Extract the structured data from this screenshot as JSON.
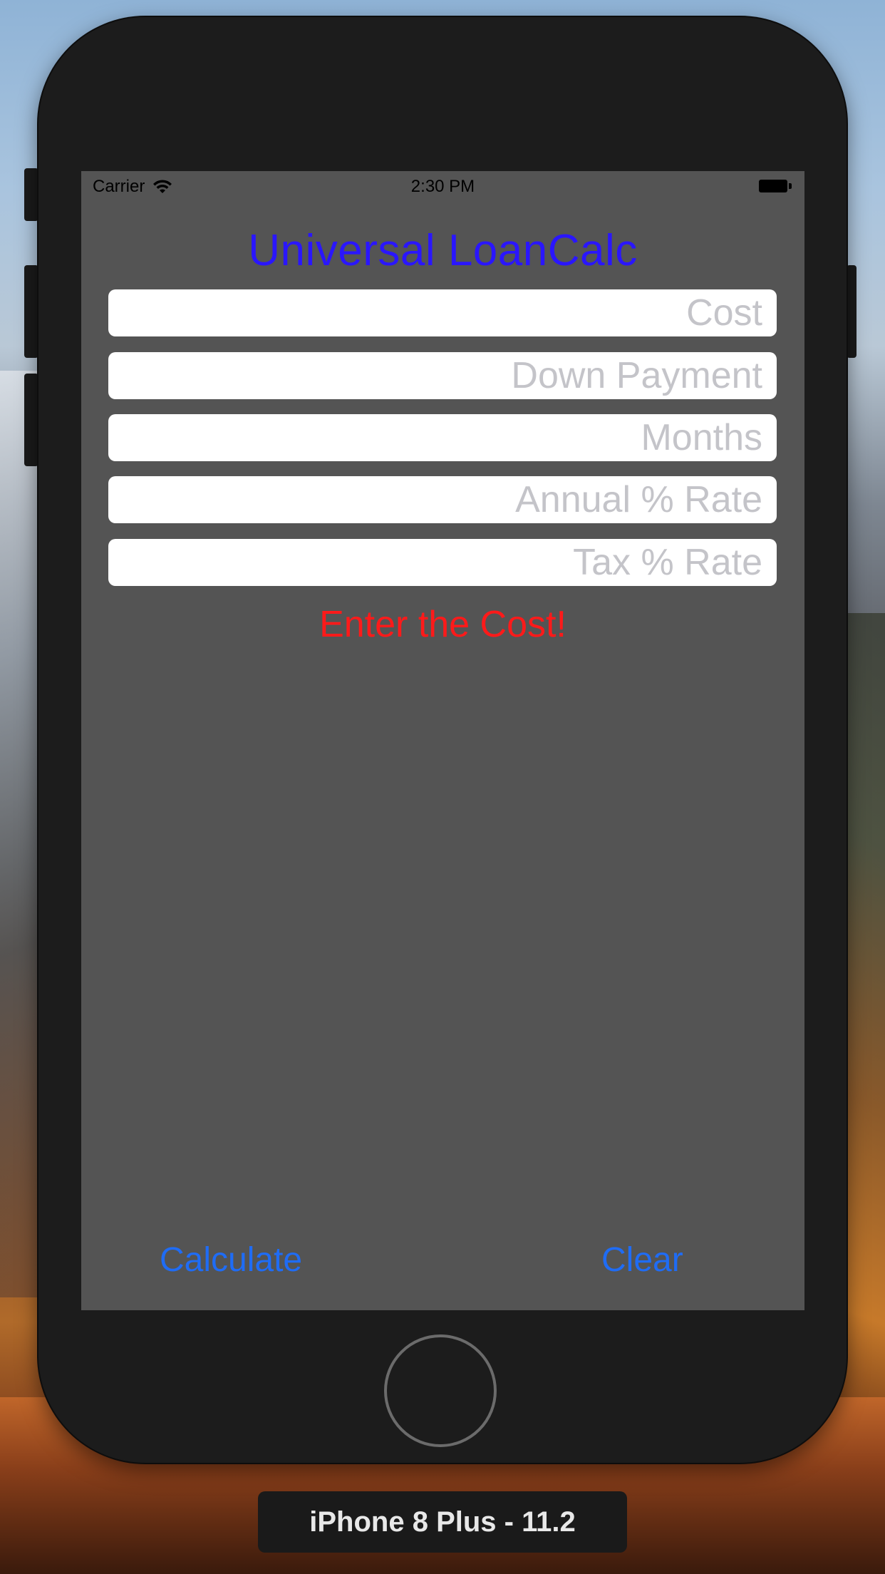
{
  "status_bar": {
    "carrier": "Carrier",
    "time": "2:30 PM"
  },
  "app": {
    "title": "Universal LoanCalc",
    "title_color": "#2a16ff",
    "fields": {
      "cost": {
        "value": "",
        "placeholder": "Cost"
      },
      "down_payment": {
        "value": "",
        "placeholder": "Down Payment"
      },
      "months": {
        "value": "",
        "placeholder": "Months"
      },
      "annual_rate": {
        "value": "",
        "placeholder": "Annual % Rate"
      },
      "tax_rate": {
        "value": "",
        "placeholder": "Tax % Rate"
      }
    },
    "error_message": "Enter the Cost!",
    "error_color": "#ff1a1a",
    "buttons": {
      "calculate": "Calculate",
      "clear": "Clear"
    },
    "button_color": "#1f6cf5",
    "screen_background": "#545454"
  },
  "simulator": {
    "device_label": "iPhone 8 Plus - 11.2"
  },
  "icons": {
    "wifi": "wifi-icon",
    "battery": "battery-icon",
    "home": "home-button"
  }
}
